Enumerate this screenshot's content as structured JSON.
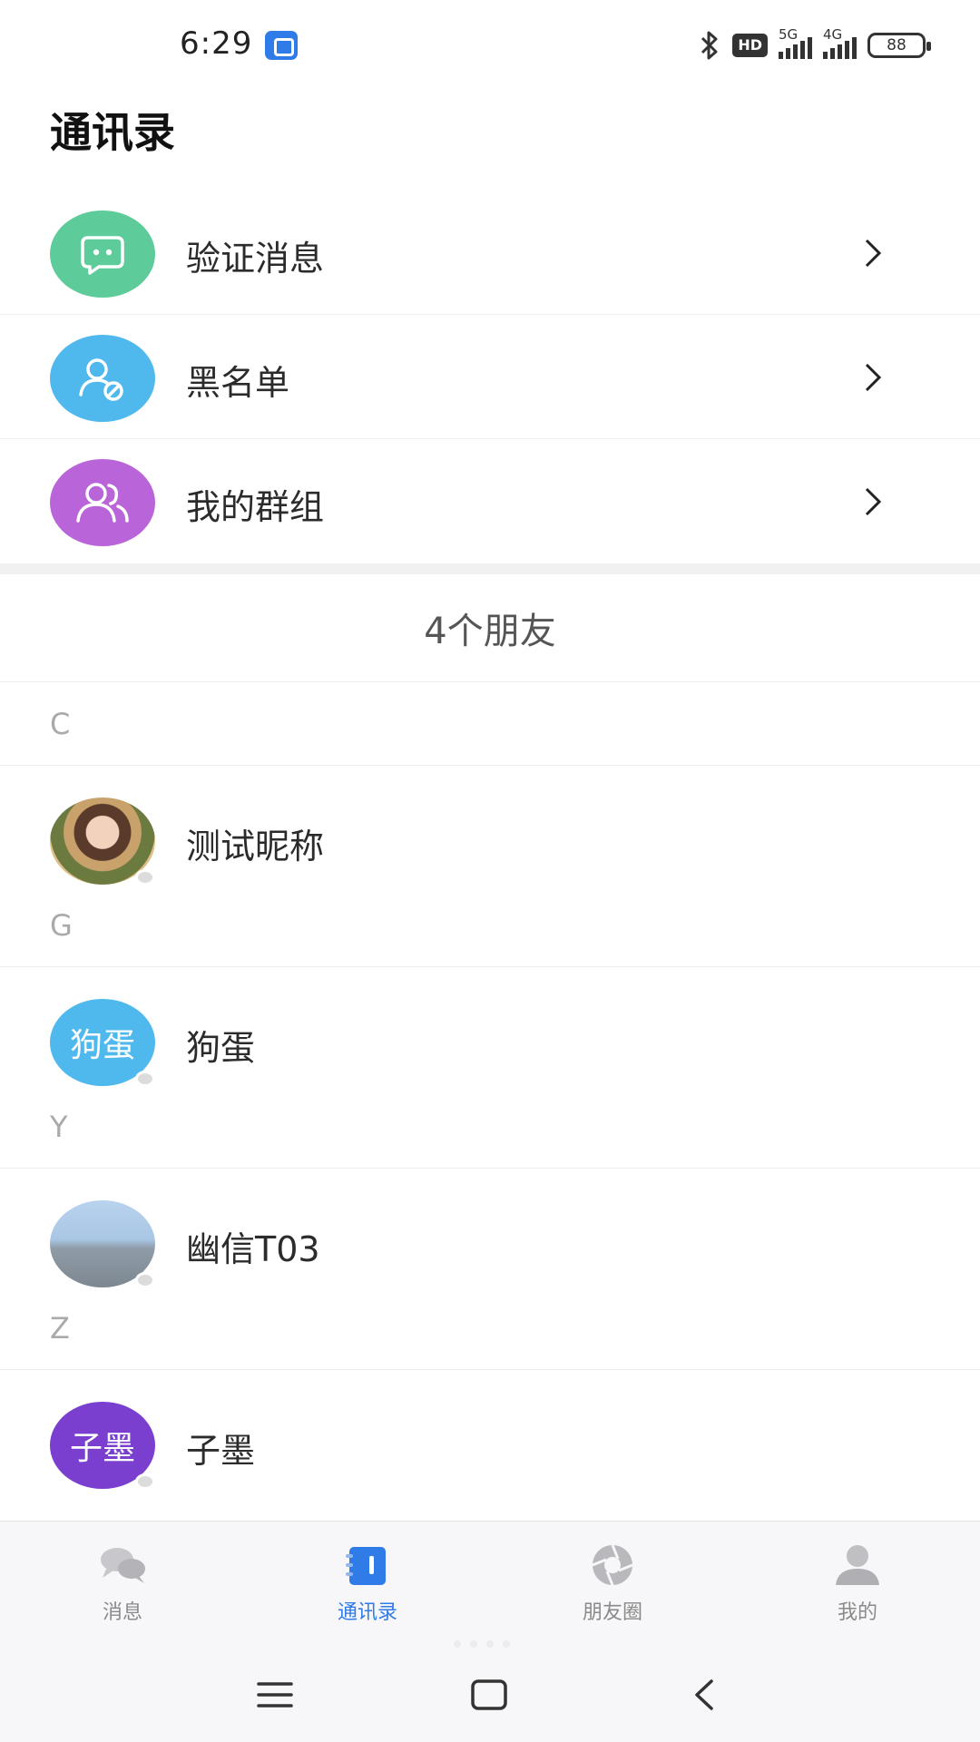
{
  "status_bar": {
    "time": "6:29",
    "hd_label": "HD",
    "net1": "5G",
    "net2": "4G",
    "battery": "88"
  },
  "header": {
    "title": "通讯录"
  },
  "menu": {
    "items": [
      {
        "label": "验证消息",
        "color": "#5ecb9a",
        "icon": "chat-bubble-icon"
      },
      {
        "label": "黑名单",
        "color": "#4fb9ee",
        "icon": "user-blocked-icon"
      },
      {
        "label": "我的群组",
        "color": "#b964d8",
        "icon": "group-users-icon"
      }
    ]
  },
  "friend_count": "4个朋友",
  "contacts": {
    "sections": [
      {
        "letter": "C",
        "name": "测试昵称",
        "avatar_type": "photo-girl"
      },
      {
        "letter": "G",
        "name": "狗蛋",
        "avatar_text": "狗蛋",
        "avatar_color": "#4fb9ee"
      },
      {
        "letter": "Y",
        "name": "幽信T03",
        "avatar_type": "photo-sky"
      },
      {
        "letter": "Z",
        "name": "子墨",
        "avatar_text": "子墨",
        "avatar_color": "#7b3fd0"
      }
    ]
  },
  "bottom_nav": {
    "tabs": [
      {
        "label": "消息",
        "icon": "chat-bubbles-icon"
      },
      {
        "label": "通讯录",
        "icon": "contacts-book-icon",
        "active": true
      },
      {
        "label": "朋友圈",
        "icon": "aperture-icon"
      },
      {
        "label": "我的",
        "icon": "person-icon"
      }
    ],
    "accent": "#2f7be8"
  }
}
